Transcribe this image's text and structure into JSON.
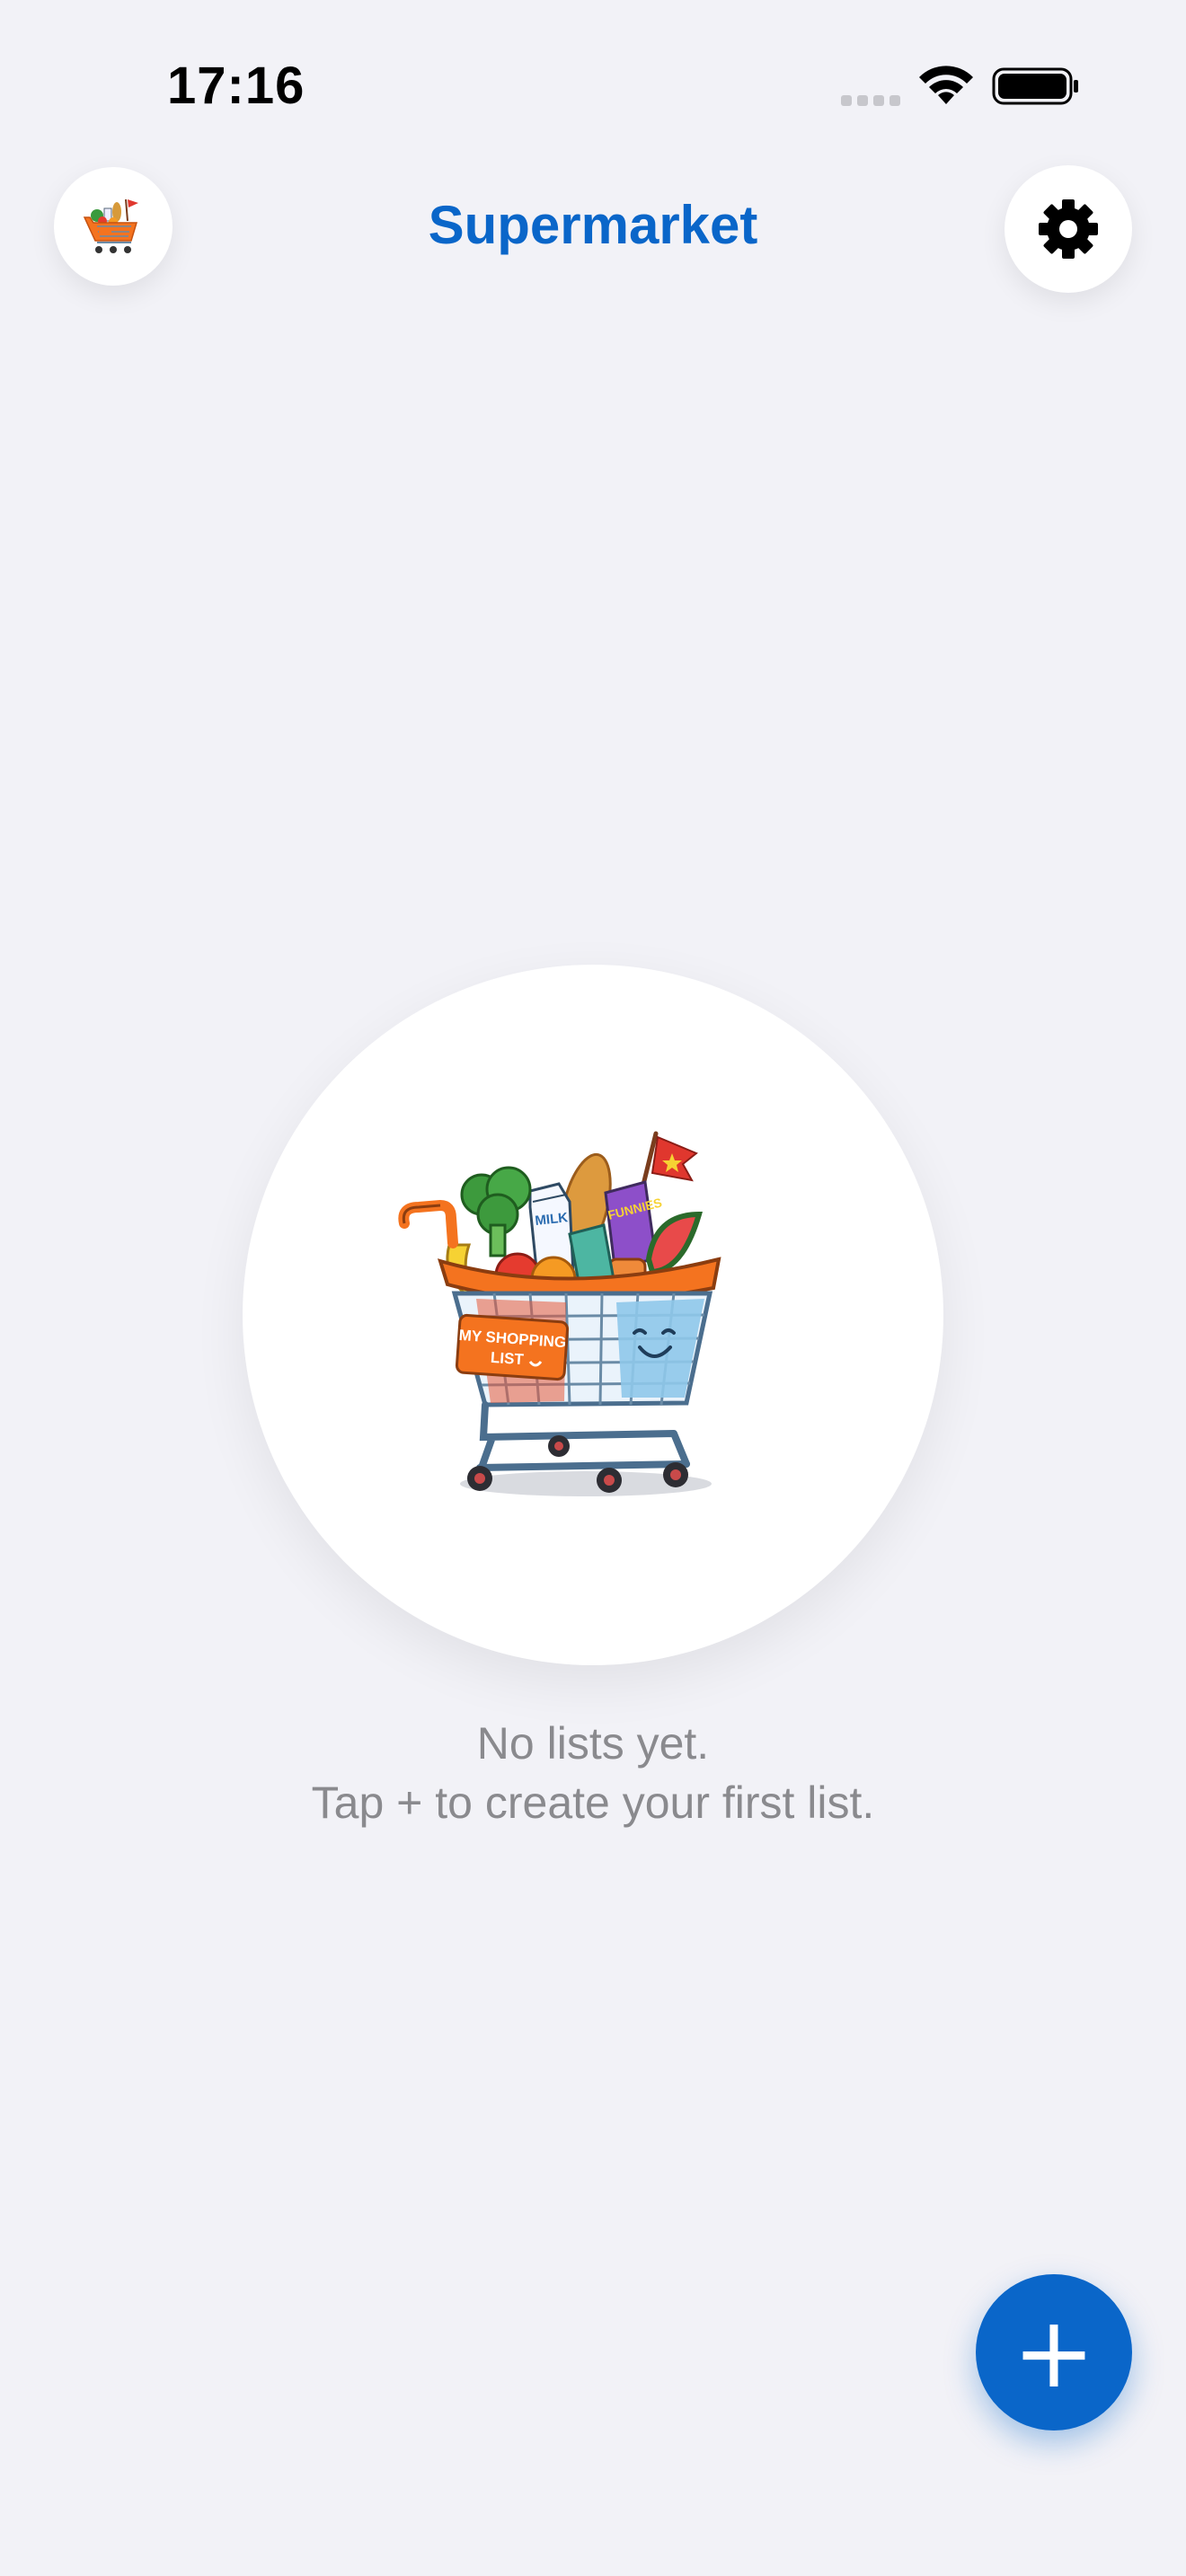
{
  "status_bar": {
    "time": "17:16"
  },
  "nav": {
    "title": "Supermarket",
    "logo_icon": "shopping-cart-logo-icon",
    "settings_icon": "gear-icon"
  },
  "empty_state": {
    "illustration": "shopping-cart-illustration",
    "cart_label_line1": "MY SHOPPING",
    "cart_label_line2": "LIST",
    "milk_label": "MILK",
    "cereal_label": "FUNNIES",
    "line1": "No lists yet.",
    "line2": "Tap + to create your first list."
  },
  "fab": {
    "label": "+",
    "icon": "plus-icon"
  },
  "colors": {
    "background": "#f2f2f7",
    "accent": "#0a66c9",
    "secondary_text": "#8a8a8e"
  }
}
